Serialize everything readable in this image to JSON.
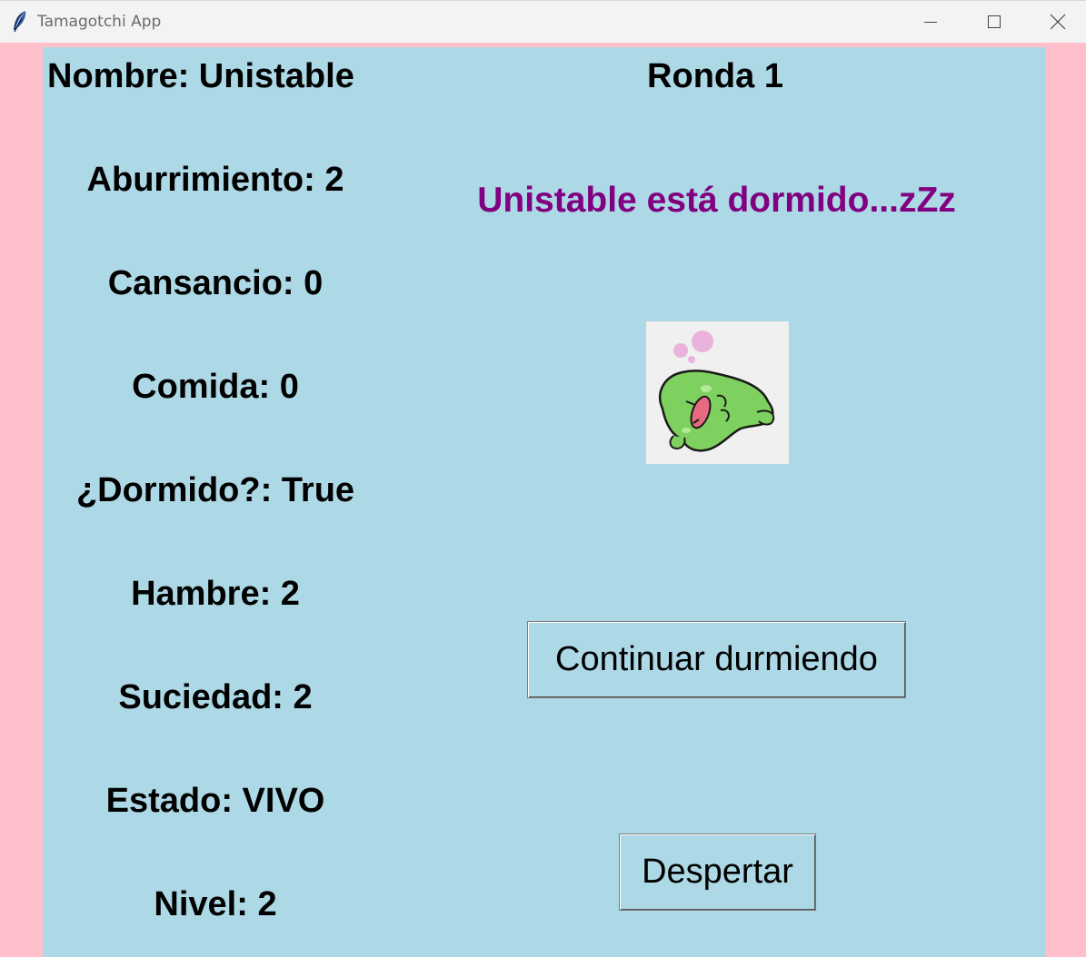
{
  "window": {
    "title": "Tamagotchi App",
    "background_color": "#ffc0cb",
    "panel_color": "#add8e6"
  },
  "stats": {
    "name": "Nombre: Unistable",
    "boredom": "Aburrimiento: 2",
    "tiredness": "Cansancio: 0",
    "food": "Comida: 0",
    "asleep": "¿Dormido?: True",
    "hunger": "Hambre: 2",
    "dirtiness": "Suciedad: 2",
    "state": "Estado: VIVO",
    "level": "Nivel: 2"
  },
  "round": "Ronda 1",
  "message": {
    "text": "Unistable está dormido...zZz",
    "color": "#800080"
  },
  "pet_image": {
    "icon": "sleeping-green-blob-pet"
  },
  "buttons": {
    "continue_label": "Continuar durmiendo",
    "wake_label": "Despertar"
  }
}
